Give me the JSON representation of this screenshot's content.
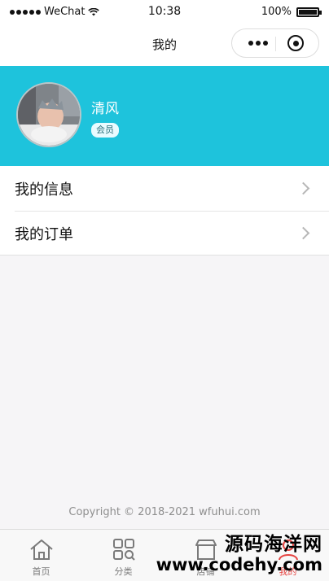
{
  "status_bar": {
    "carrier": "WeChat",
    "time": "10:38",
    "battery": "100%"
  },
  "nav": {
    "title": "我的"
  },
  "profile": {
    "username": "清风",
    "badge": "会员"
  },
  "menu": {
    "items": [
      {
        "label": "我的信息"
      },
      {
        "label": "我的订单"
      }
    ]
  },
  "footer": {
    "copyright": "Copyright © 2018-2021 wfuhui.com"
  },
  "tabbar": {
    "items": [
      {
        "label": "首页",
        "icon": "home-icon"
      },
      {
        "label": "分类",
        "icon": "category-icon"
      },
      {
        "label": "店铺",
        "icon": "shop-icon"
      },
      {
        "label": "我的",
        "icon": "user-icon"
      }
    ],
    "active_index": 3
  },
  "watermark": {
    "line1": "源码海洋网",
    "line2": "www.codehy.com"
  },
  "colors": {
    "accent": "#1ec3dc",
    "active_tab": "#e64340"
  }
}
